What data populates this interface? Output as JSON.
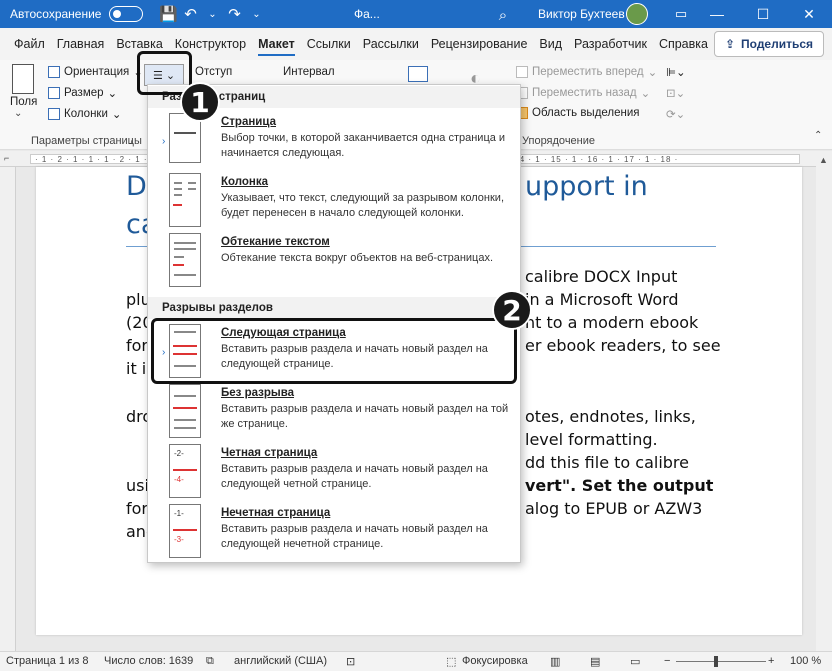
{
  "titlebar": {
    "autosave_label": "Автосохранение",
    "doc_name": "Фа...",
    "user_name": "Виктор Бухтеев",
    "minimize": "—",
    "maximize": "☐",
    "close": "✕"
  },
  "tabs": [
    "Файл",
    "Главная",
    "Вставка",
    "Конструктор",
    "Макет",
    "Ссылки",
    "Рассылки",
    "Рецензирование",
    "Вид",
    "Разработчик",
    "Справка"
  ],
  "active_tab": "Макет",
  "share_label": "Поделиться",
  "ribbon": {
    "fields_label": "Поля",
    "orientation_label": "Ориентация",
    "size_label": "Размер",
    "columns_label": "Колонки",
    "indent_label": "Отступ",
    "interval_label": "Интервал",
    "move_forward": "Переместить вперед",
    "move_back": "Переместить назад",
    "selection_pane": "Область выделения",
    "group_page_setup": "Параметры страницы",
    "group_arrange": "Упорядочение"
  },
  "ruler_text": "· 1 · 2 · 1 · 1 · 1 · 2 · 1 · 3 · 1 · 4 · 1 · 5 · 1 · 6 · 1 · 7 · 1 · 8 · 1 · 9 · 1 · 10 · 1 · 11 · 1 · 12 · 1 · 13 · 1 · 14 · 1 · 15 · 1 · 16 · 1 · 17 · 1 · 18 ·",
  "document": {
    "heading_left_1": "D",
    "heading_right_1": "upport in",
    "heading_left_2": "ca",
    "lines": [
      {
        "left": "",
        "right": "calibre DOCX Input"
      },
      {
        "left": "plu",
        "right": "in a Microsoft Word"
      },
      {
        "left": "(20",
        "right": "nt to a modern ebook"
      },
      {
        "left": "for",
        "right": "er ebook readers, to see"
      },
      {
        "left": "it i",
        "right": ""
      },
      {
        "left": "dro",
        "right": "otes, endnotes, links,"
      },
      {
        "left": "",
        "right": "level formatting."
      },
      {
        "left": "",
        "right": "dd this file to calibre"
      },
      {
        "left": "usi",
        "right": "vert\".  Set the output"
      },
      {
        "left": "for",
        "right": "alog to EPUB or AZW3"
      },
      {
        "left": "and",
        "right": ""
      }
    ]
  },
  "menu": {
    "section_page_breaks": "Разрывы страниц",
    "section_section_breaks": "Разрывы разделов",
    "items": [
      {
        "title": "Страница",
        "desc": "Выбор точки, в которой заканчивается одна страница и начинается следующая."
      },
      {
        "title": "Колонка",
        "desc": "Указывает, что текст, следующий за разрывом колонки, будет перенесен в начало следующей колонки."
      },
      {
        "title": "Обтекание текстом",
        "desc": "Обтекание текста вокруг объектов на веб-страницах."
      },
      {
        "title": "Следующая страница",
        "desc": "Вставить разрыв раздела и начать новый раздел на следующей странице."
      },
      {
        "title": "Без разрыва",
        "desc": "Вставить разрыв раздела и начать новый раздел на той же странице."
      },
      {
        "title": "Четная страница",
        "desc": "Вставить разрыв раздела и начать новый раздел на следующей четной странице."
      },
      {
        "title": "Нечетная страница",
        "desc": "Вставить разрыв раздела и начать новый раздел на следующей нечетной странице."
      }
    ]
  },
  "badges": {
    "one": "1",
    "two": "2"
  },
  "status": {
    "page": "Страница 1 из 8",
    "words": "Число слов: 1639",
    "language": "английский (США)",
    "focus": "Фокусировка",
    "zoom": "100 %"
  }
}
